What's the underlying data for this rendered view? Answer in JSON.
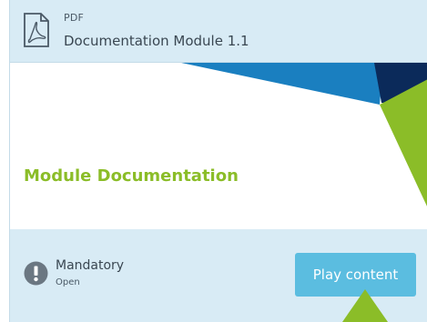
{
  "card": {
    "type_label": "PDF",
    "title": "Documentation Module 1.1",
    "preview_title": "Module Documentation",
    "status": "Mandatory",
    "status_sub": "Open",
    "play_label": "Play content"
  },
  "icons": {
    "file": "pdf-file-icon",
    "status": "exclamation-circle-icon"
  },
  "colors": {
    "card_bg": "#d8ebf5",
    "accent_green": "#8bbd28",
    "button_blue": "#5bbde0",
    "navy": "#0b2a5a",
    "mid_blue": "#1a7fc0"
  }
}
